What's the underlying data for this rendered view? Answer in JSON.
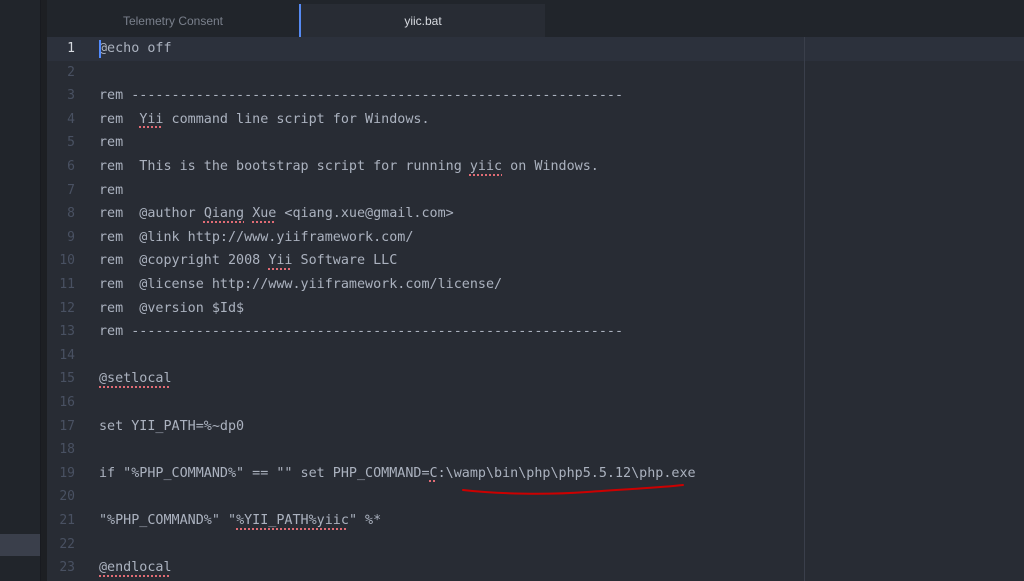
{
  "tabs": [
    {
      "label": "Telemetry Consent",
      "active": false
    },
    {
      "label": "yiic.bat",
      "active": true
    }
  ],
  "editor": {
    "current_line": 1,
    "lines": [
      "@echo off",
      "",
      "rem -------------------------------------------------------------",
      "rem  Yii command line script for Windows.",
      "rem",
      "rem  This is the bootstrap script for running yiic on Windows.",
      "rem",
      "rem  @author Qiang Xue <qiang.xue@gmail.com>",
      "rem  @link http://www.yiiframework.com/",
      "rem  @copyright 2008 Yii Software LLC",
      "rem  @license http://www.yiiframework.com/license/",
      "rem  @version $Id$",
      "rem -------------------------------------------------------------",
      "",
      "@setlocal",
      "",
      "set YII_PATH=%~dp0",
      "",
      "if \"%PHP_COMMAND%\" == \"\" set PHP_COMMAND=C:\\wamp\\bin\\php\\php5.5.12\\php.exe",
      "",
      "\"%PHP_COMMAND%\" \"%YII_PATH%yiic\" %*",
      "",
      "@endlocal"
    ]
  },
  "colors": {
    "background": "#282c34",
    "text": "#abb2bf",
    "line_number": "#495162",
    "accent": "#568af2",
    "spellcheck": "#e06c75",
    "annotation": "#cc0000"
  }
}
